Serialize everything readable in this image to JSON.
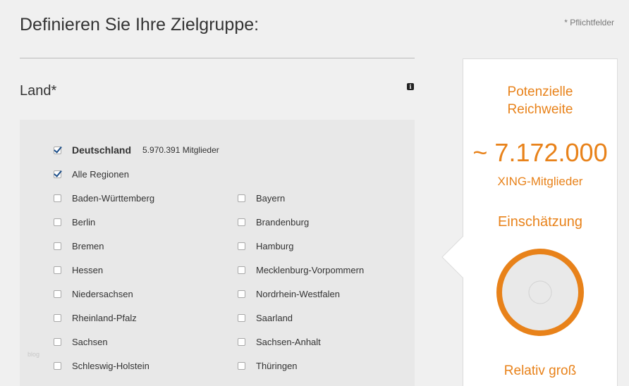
{
  "header": {
    "title": "Definieren Sie Ihre Zielgruppe:",
    "required_note": "* Pflichtfelder"
  },
  "section": {
    "title": "Land*",
    "info_icon": "info-icon"
  },
  "country": {
    "label": "Deutschland",
    "members": "5.970.391 Mitglieder",
    "checked": true
  },
  "all_regions": {
    "label": "Alle Regionen",
    "checked": true
  },
  "regions_left": [
    "Baden-Württemberg",
    "Berlin",
    "Bremen",
    "Hessen",
    "Niedersachsen",
    "Rheinland-Pfalz",
    "Sachsen",
    "Schleswig-Holstein"
  ],
  "regions_right": [
    "Bayern",
    "Brandenburg",
    "Hamburg",
    "Mecklenburg-Vorpommern",
    "Nordrhein-Westfalen",
    "Saarland",
    "Sachsen-Anhalt",
    "Thüringen"
  ],
  "watermark": "blog",
  "reach": {
    "title_line1": "Potenzielle",
    "title_line2": "Reichweite",
    "value": "~ 7.172.000",
    "unit": "XING-Mitglieder",
    "estimate_title": "Einschätzung",
    "estimate_value": "Relativ groß"
  },
  "colors": {
    "accent": "#e8821a",
    "check": "#1d4f8a",
    "panel": "#e8e8e8"
  }
}
